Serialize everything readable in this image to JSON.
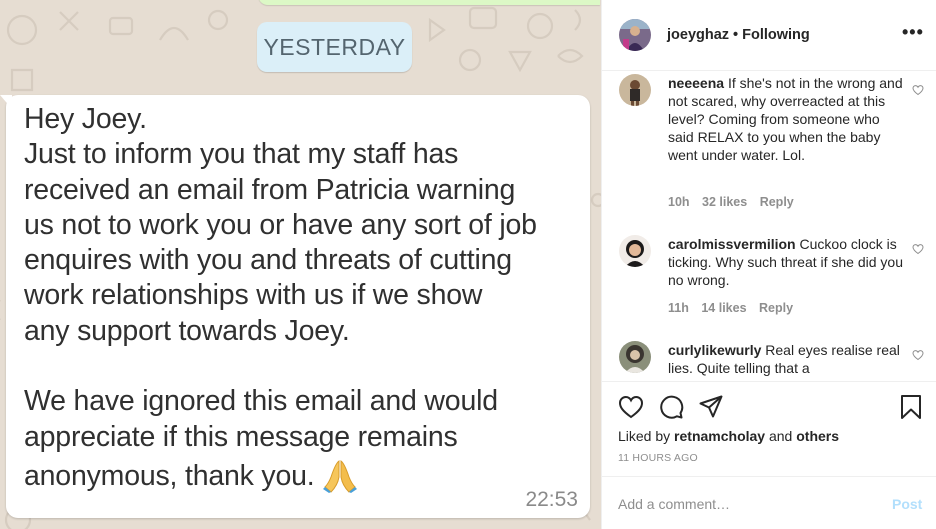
{
  "chat": {
    "date_label": "YESTERDAY",
    "message_lines": [
      "Hey Joey.",
      "Just to inform you that my staff has",
      "received an email from Patricia warning",
      "us not to work you or have any sort of job",
      "enquires with you and threats of cutting",
      "work relationships with us if we show",
      "any support towards Joey.",
      "",
      "We have ignored this email and would",
      "appreciate if this message remains",
      "anonymous, thank you."
    ],
    "emoji_icon": "folded-hands-icon",
    "time": "22:53"
  },
  "post": {
    "username": "joeyghaz",
    "follow_status": "• Following",
    "more_icon": "•••",
    "comments": [
      {
        "username": "neeeena",
        "text": "If she's not in the wrong and not scared, why overreacted at this level? Coming from someone who said RELAX to you when the baby went under water. Lol.",
        "age": "10h",
        "likes": "32 likes",
        "reply": "Reply"
      },
      {
        "username": "carolmissvermilion",
        "text": "Cuckoo clock is ticking. Why such threat if she did you no wrong.",
        "age": "11h",
        "likes": "14 likes",
        "reply": "Reply"
      },
      {
        "username": "curlylikewurly",
        "text": "Real eyes realise real lies. Quite telling that a",
        "age": "",
        "likes": "",
        "reply": ""
      }
    ],
    "liked_by_prefix": "Liked by ",
    "liked_by_user": "retnamcholay",
    "liked_by_and": " and ",
    "liked_by_others": "others",
    "time_ago": "11 HOURS AGO",
    "comment_placeholder": "Add a comment…",
    "post_label": "Post",
    "colors": {
      "link_disabled": "#b2dffc",
      "muted": "#8e8e8e",
      "bubble": "#ffffff",
      "chat_bg": "#e6ddd2",
      "date_pill": "#dbeff8"
    }
  }
}
